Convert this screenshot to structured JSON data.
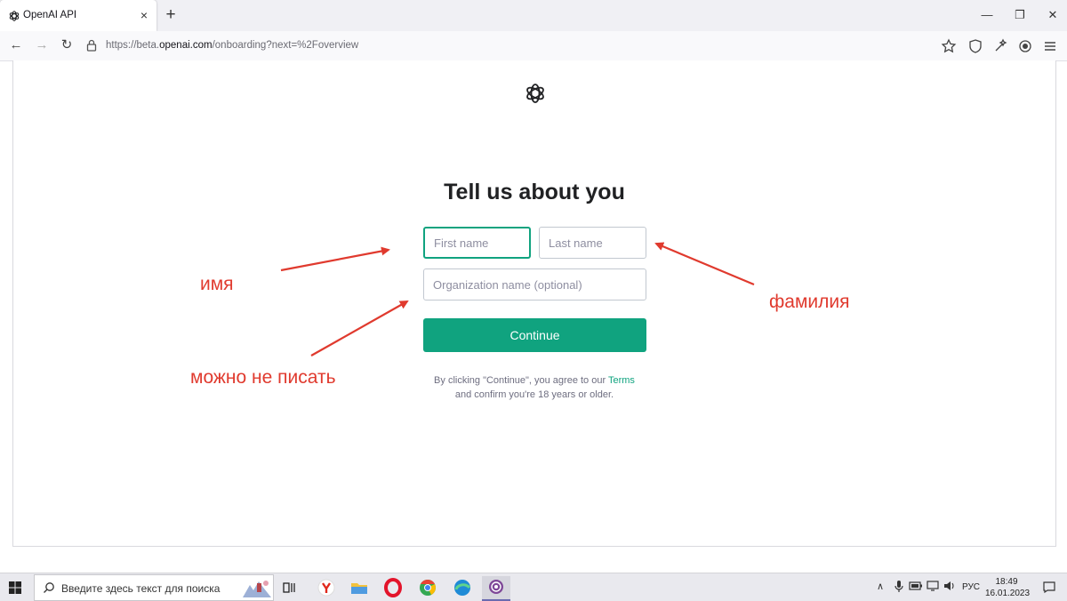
{
  "browser": {
    "tab_title": "OpenAI API",
    "tab_close": "×",
    "new_tab": "+",
    "window_controls": {
      "minimize": "—",
      "restore": "❐",
      "close": "✕"
    },
    "nav": {
      "back": "←",
      "forward": "→",
      "reload": "↻"
    },
    "url_prefix": "https://beta.",
    "url_host": "openai.com",
    "url_path": "/onboarding?next=%2Foverview",
    "toolbar_icons": [
      "star-icon",
      "shield-icon",
      "extension-icon",
      "account-icon",
      "menu-icon"
    ]
  },
  "page": {
    "title": "Tell us about you",
    "first_name_placeholder": "First name",
    "last_name_placeholder": "Last name",
    "org_placeholder": "Organization name (optional)",
    "continue_label": "Continue",
    "terms_before": "By clicking \"Continue\", you agree to our ",
    "terms_link": "Terms",
    "terms_after": "and confirm you're 18 years or older.",
    "accent_color": "#10a37f"
  },
  "annotations": {
    "name": "имя",
    "surname": "фамилия",
    "optional": "можно не писать",
    "color": "#e03a2e"
  },
  "taskbar": {
    "search_placeholder": "Введите здесь текст для поиска",
    "apps": [
      "task-view",
      "yandex-browser",
      "file-explorer",
      "opera",
      "chrome",
      "edge",
      "tor-browser"
    ],
    "language": "РУС",
    "time": "18:49",
    "date": "16.01.2023"
  }
}
